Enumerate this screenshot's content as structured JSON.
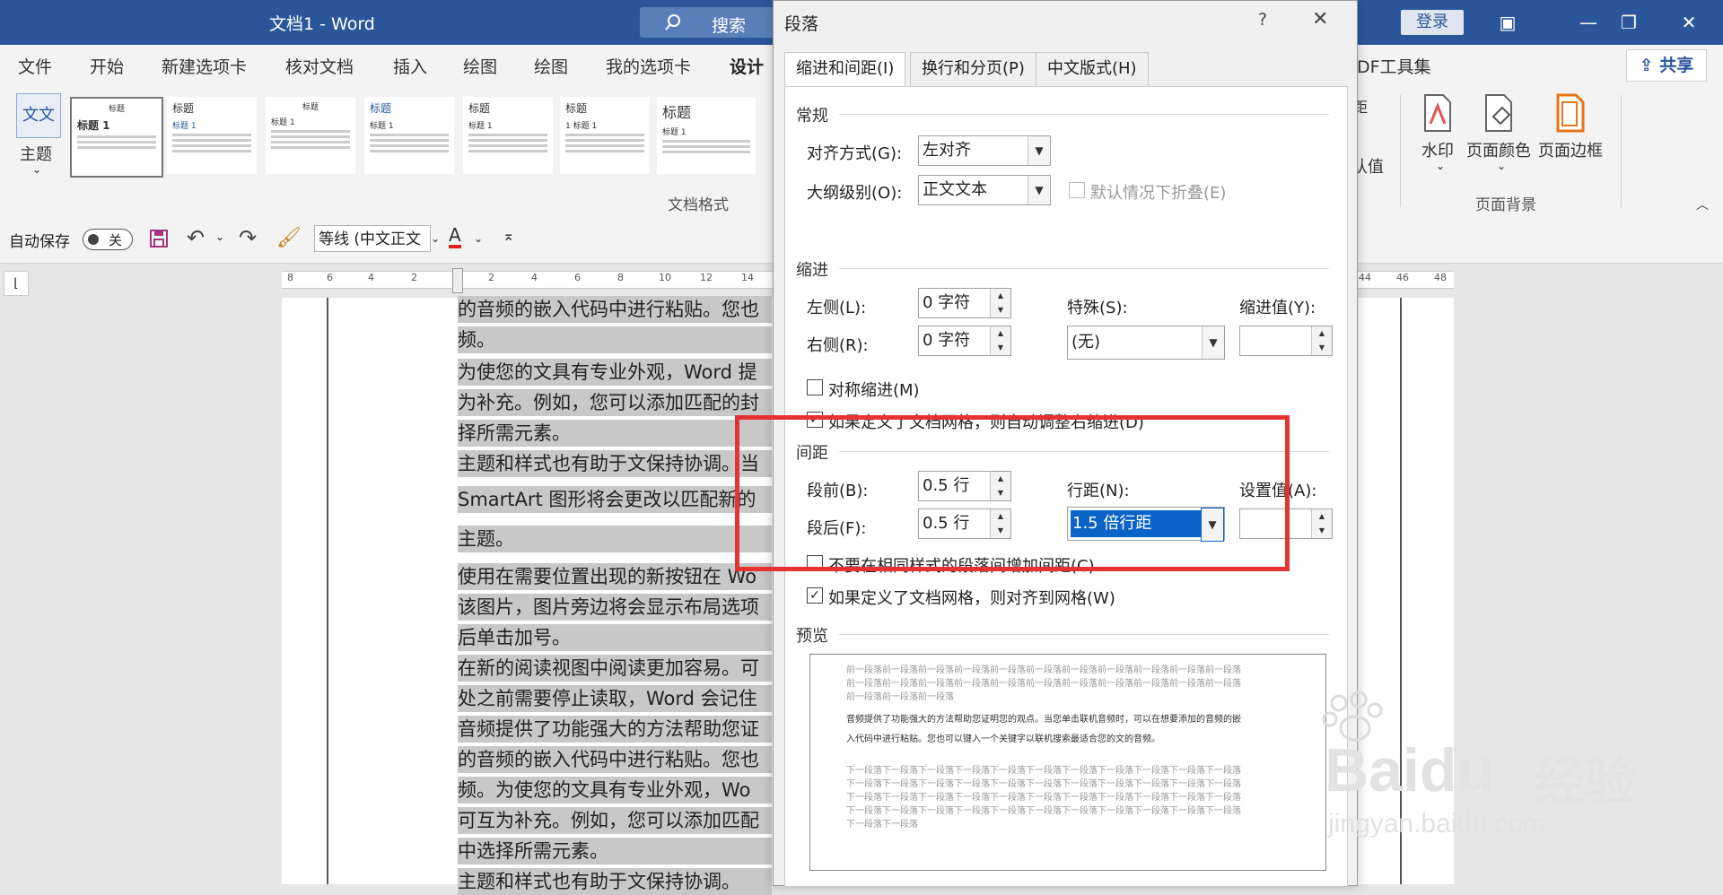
{
  "titlebar": {
    "title": "文档1  -  Word",
    "search": "搜索",
    "login": "登录"
  },
  "menu": {
    "tabs": [
      "文件",
      "开始",
      "新建选项卡",
      "核对文档",
      "插入",
      "绘图",
      "绘图",
      "我的选项卡",
      "设计"
    ],
    "active": "设计",
    "share": "共享",
    "pdf_tools": "DF工具集"
  },
  "ribbon": {
    "theme_label": "主题",
    "theme_icon_text": "文文",
    "doc_format_label": "文档格式",
    "gallery": [
      {
        "title": "标题",
        "subtitle": "标题 1"
      },
      {
        "title": "标题",
        "subtitle": "标题 1"
      },
      {
        "title": "标题",
        "subtitle": "标题 1"
      },
      {
        "title": "标题",
        "subtitle": "标题 1"
      },
      {
        "title": "标题",
        "subtitle": "标题 1"
      },
      {
        "title": "标题",
        "subtitle": "1 标题 1"
      },
      {
        "title": "标题",
        "subtitle": "标题 1"
      }
    ],
    "partial_1": "距",
    "partial_2": "认值",
    "watermark": "水印",
    "page_color": "页面颜色",
    "page_border": "页面边框",
    "page_bg_group": "页面背景"
  },
  "qat": {
    "autosave": "自动保存",
    "toggle": "关",
    "font": "等线 (中文正文",
    "font_color_letter": "A"
  },
  "ruler": [
    "8",
    "6",
    "4",
    "2",
    "2",
    "4",
    "6",
    "8",
    "10",
    "12",
    "14",
    "44",
    "46",
    "48"
  ],
  "doc_lines": [
    "的音频的嵌入代码中进行粘贴。您也",
    "频。",
    "为使您的文具有专业外观，Word 提",
    "为补充。例如，您可以添加匹配的封",
    "择所需元素。",
    "主题和样式也有助于文保持协调。当",
    "SmartArt 图形将会更改以匹配新的",
    "主题。",
    "使用在需要位置出现的新按钮在 Wo",
    "该图片，图片旁边将会显示布局选项",
    "后单击加号。",
    "在新的阅读视图中阅读更加容易。可",
    "处之前需要停止读取，Word 会记住",
    "音频提供了功能强大的方法帮助您证",
    "的音频的嵌入代码中进行粘贴。您也",
    "频。为使您的文具有专业外观，Wo",
    "可互为补充。例如，您可以添加匹配",
    "中选择所需元素。",
    "主题和样式也有助于文保持协调。"
  ],
  "dialog": {
    "title": "段落",
    "help": "?",
    "tabs": [
      "缩进和间距(I)",
      "换行和分页(P)",
      "中文版式(H)"
    ],
    "general": {
      "section": "常规",
      "align_label": "对齐方式(G):",
      "align_value": "左对齐",
      "outline_label": "大纲级别(O):",
      "outline_value": "正文文本",
      "collapse_label": "默认情况下折叠(E)"
    },
    "indent": {
      "section": "缩进",
      "left_label": "左侧(L):",
      "left_value": "0 字符",
      "right_label": "右侧(R):",
      "right_value": "0 字符",
      "special_label": "特殊(S):",
      "special_value": "(无)",
      "indent_value_label": "缩进值(Y):",
      "mirror_label": "对称缩进(M)",
      "auto_adjust_label": "如果定义了文档网格，则自动调整右缩进(D)"
    },
    "spacing": {
      "section": "间距",
      "before_label": "段前(B):",
      "before_value": "0.5 行",
      "after_label": "段后(F):",
      "after_value": "0.5 行",
      "line_label": "行距(N):",
      "line_value": "1.5 倍行距",
      "set_label": "设置值(A):",
      "no_space_label": "不要在相同样式的段落间增加间距(C)",
      "snap_grid_label": "如果定义了文档网格，则对齐到网格(W)"
    },
    "preview": {
      "section": "预览",
      "before_lines": [
        "前一段落前一段落前一段落前一段落前一段落前一段落前一段落前一段落前一段落前一段落前一段落",
        "前一段落前一段落前一段落前一段落前一段落前一段落前一段落前一段落前一段落前一段落前一段落",
        "前一段落前一段落前一段落"
      ],
      "sample_lines": [
        "音频提供了功能强大的方法帮助您证明您的观点。当您单击联机音频时，可以在想要添加的音频的嵌",
        "入代码中进行粘贴。您也可以键入一个关键字以联机搜索最适合您的文的音频。"
      ],
      "after_lines": [
        "下一段落下一段落下一段落下一段落下一段落下一段落下一段落下一段落下一段落下一段落下一段落",
        "下一段落下一段落下一段落下一段落下一段落下一段落下一段落下一段落下一段落下一段落下一段落",
        "下一段落下一段落下一段落下一段落下一段落下一段落下一段落下一段落下一段落下一段落下一段落",
        "下一段落下一段落下一段落下一段落下一段落下一段落下一段落下一段落下一段落下一段落下一段落",
        "下一段落下一段落"
      ]
    }
  },
  "watermark": {
    "brand": "Baidu",
    "brand_cn": "经验",
    "url": "jingyan.baidu.com"
  },
  "colors": {
    "word_blue": "#2b579a",
    "highlight_red": "#e53333",
    "selection_blue": "#0a64c8"
  }
}
